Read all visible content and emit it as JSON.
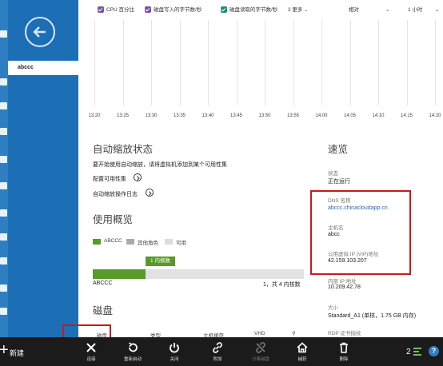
{
  "legend": {
    "items": [
      "CPU 百分比",
      "磁盘写入的字节数/秒",
      "磁盘读取的字节数/秒"
    ],
    "more": "2 更多",
    "mode": "相对",
    "range": "1 小时"
  },
  "nav": {
    "selected": "abccc"
  },
  "chart_data": {
    "type": "line",
    "x": [
      "13:20",
      "13:25",
      "13:30",
      "13:35",
      "13:40",
      "13:45",
      "13:50",
      "13:55",
      "14:00",
      "14:05",
      "14:10",
      "14:15",
      "14:20"
    ],
    "series": []
  },
  "autoscale": {
    "title": "自动缩放状态",
    "desc": "要开始使用自动缩放，请将虚拟机添加到某个可用性集",
    "config_link": "配置可用性集",
    "log_link": "自动缩放操作日志"
  },
  "usage": {
    "title": "使用概览",
    "legend": [
      "ABCCC",
      "其他角色",
      "可用"
    ],
    "badge": "1 内核数",
    "name": "ABCCC",
    "summary": "1，共 4 内核数",
    "fraction": 0.25
  },
  "disks": {
    "title": "磁盘",
    "cols": [
      "磁盘",
      "类型",
      "主机缓存",
      "VHD"
    ]
  },
  "quick": {
    "title": "速览",
    "status_label": "状态",
    "status_value": "正在运行",
    "dns_label": "DNS 名称",
    "dns_value": "abccc.chinacloudapp.cn",
    "host_label": "主机名",
    "host_value": "abcc",
    "vip_label": "公用虚拟 IP (VIP)地址",
    "vip_value": "42.159.103.207",
    "internal_label": "内部 IP 地址",
    "internal_value": "10.209.42.78",
    "size_label": "大小",
    "size_value": "Standard_A1 (单核，1.75 GB 内存)",
    "rdp_label": "RDP 证书指纹"
  },
  "cmdbar": {
    "new": "新建",
    "connect": "连接",
    "restart": "重新启动",
    "shutdown": "关闭",
    "attach": "附加",
    "detach": "分离磁盘",
    "capture": "捕获",
    "delete": "删除",
    "count": "2"
  },
  "colors": {
    "accent": "#1c6fb5",
    "usage_green": "#5a9a28",
    "highlight": "#c41b1b"
  }
}
